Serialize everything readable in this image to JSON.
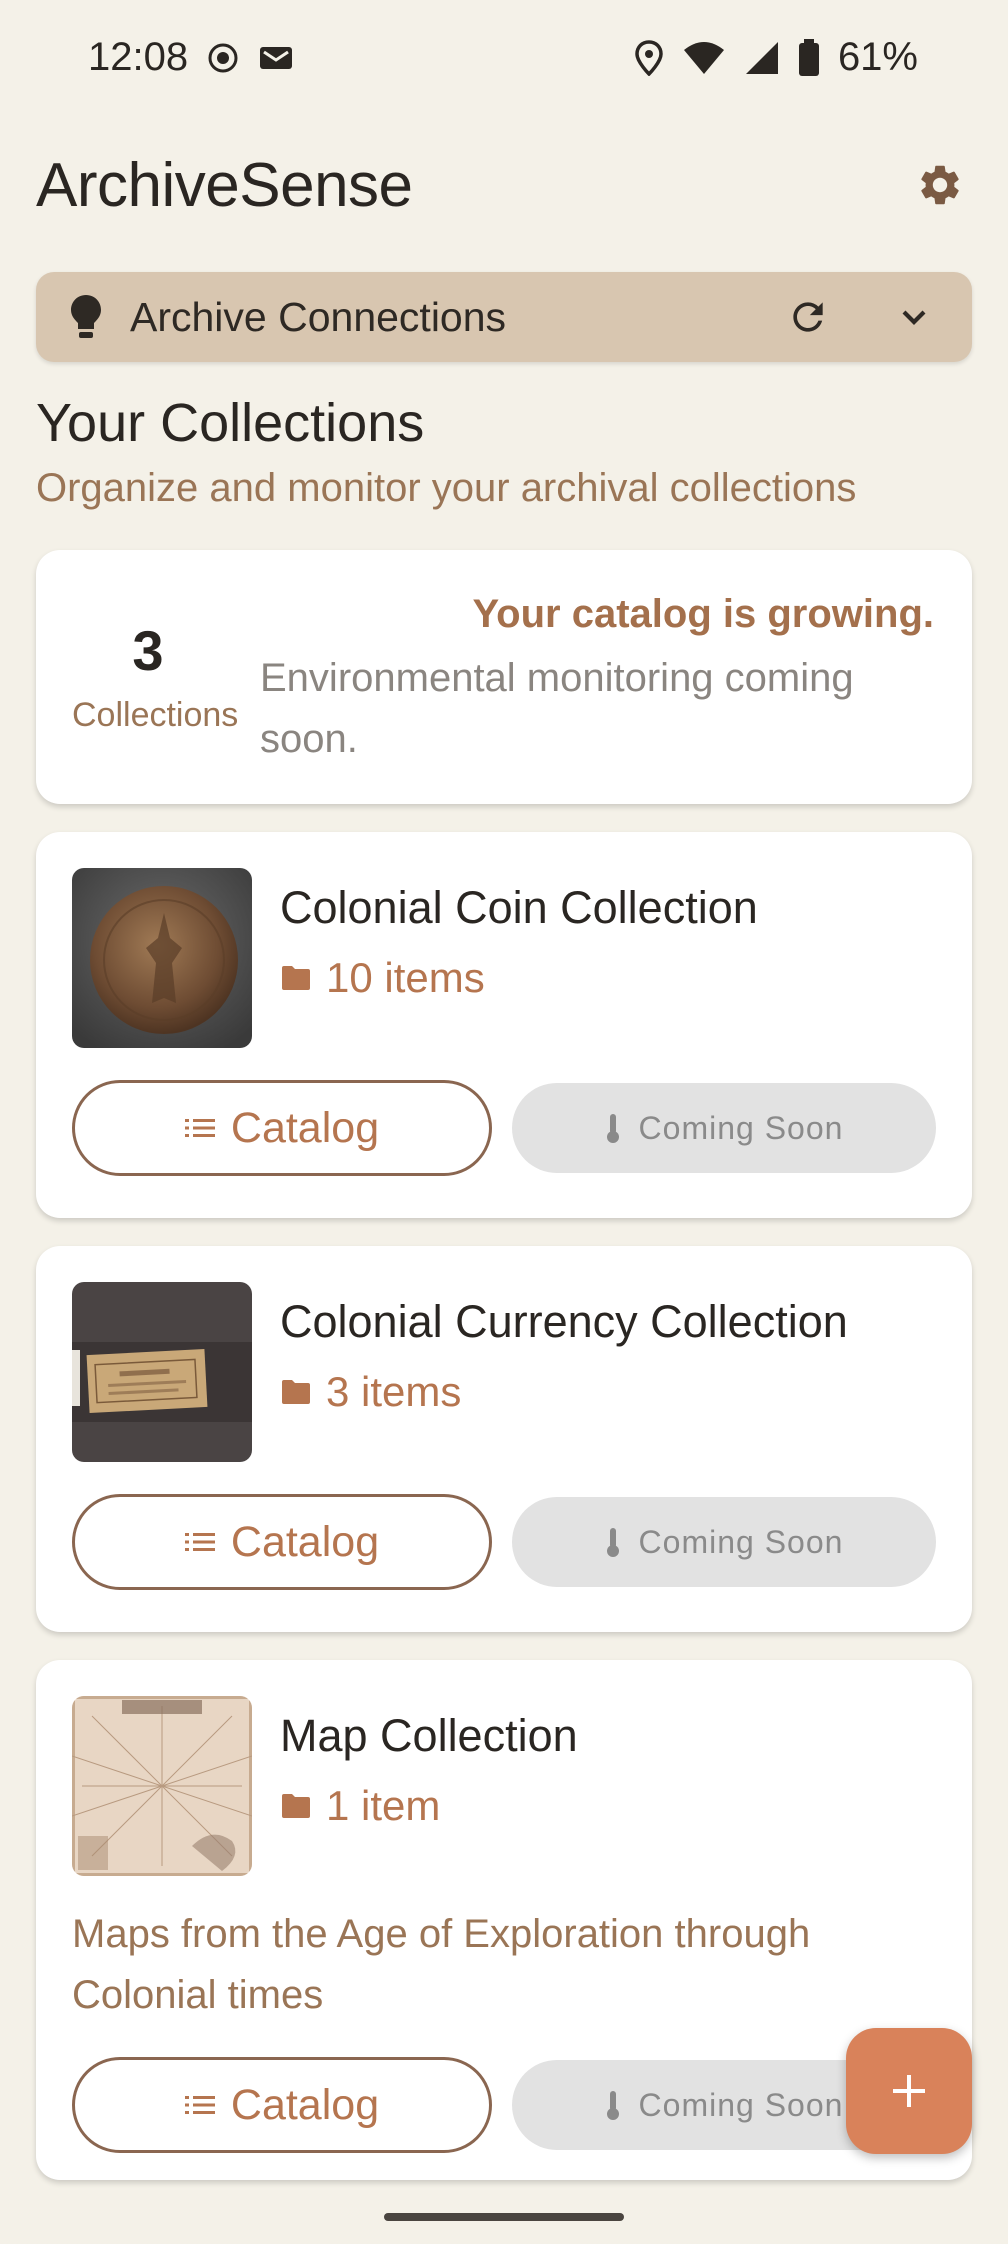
{
  "status_bar": {
    "time": "12:08",
    "battery": "61%",
    "icons": [
      "record-icon",
      "message-icon",
      "location-icon",
      "wifi-icon",
      "signal-icon",
      "battery-icon"
    ]
  },
  "header": {
    "title": "ArchiveSense",
    "settings_icon": "gear-icon"
  },
  "connections": {
    "label": "Archive Connections",
    "icons": [
      "lightbulb-icon",
      "refresh-icon",
      "chevron-down-icon"
    ]
  },
  "section": {
    "title": "Your Collections",
    "subtitle": "Organize and monitor your archival collections"
  },
  "summary": {
    "count": "3",
    "count_label": "Collections",
    "headline": "Your catalog is growing.",
    "body": "Environmental monitoring coming soon."
  },
  "collections": [
    {
      "name": "Colonial Coin Collection",
      "count": "10 items",
      "description": "",
      "catalog_label": "Catalog",
      "soon_label": "Coming Soon",
      "thumbnail": "coin-thumbnail"
    },
    {
      "name": "Colonial Currency Collection",
      "count": "3 items",
      "description": "",
      "catalog_label": "Catalog",
      "soon_label": "Coming Soon",
      "thumbnail": "banknote-thumbnail"
    },
    {
      "name": "Map Collection",
      "count": "1 item",
      "description": "Maps from the Age of Exploration through Colonial times",
      "catalog_label": "Catalog",
      "soon_label": "Coming Soon",
      "thumbnail": "map-thumbnail"
    }
  ],
  "fab": {
    "icon": "plus-icon"
  },
  "colors": {
    "background": "#f4f1e8",
    "accent": "#b5754f",
    "connections_bar": "#d8c6b0",
    "fab": "#d9825a"
  }
}
